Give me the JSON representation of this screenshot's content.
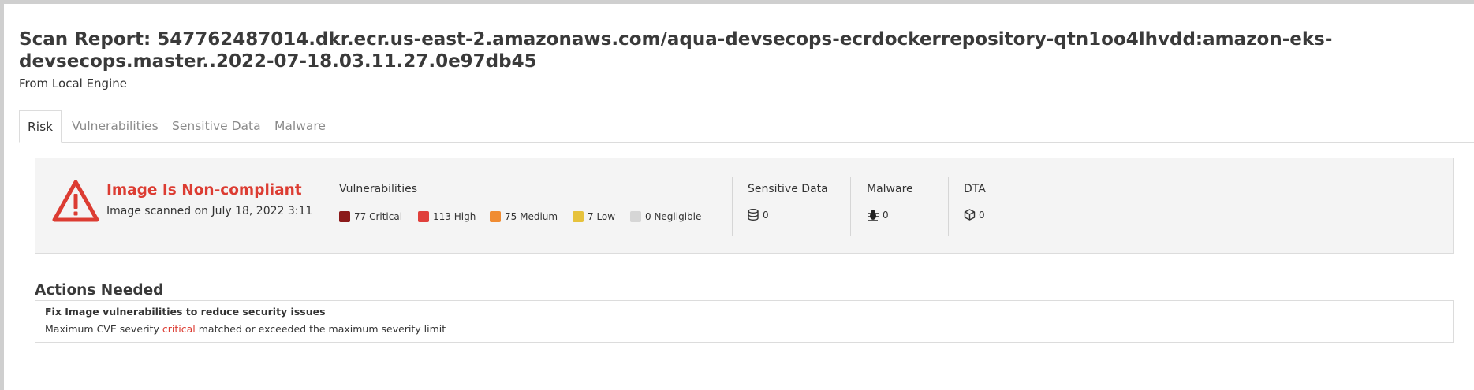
{
  "report": {
    "title": "Scan Report: 547762487014.dkr.ecr.us-east-2.amazonaws.com/aqua-devsecops-ecrdockerrepository-qtn1oo4lhvdd:amazon-eks-devsecops.master..2022-07-18.03.11.27.0e97db45",
    "source": "From Local Engine"
  },
  "tabs": [
    {
      "label": "Risk",
      "active": true
    },
    {
      "label": "Vulnerabilities",
      "active": false
    },
    {
      "label": "Sensitive Data",
      "active": false
    },
    {
      "label": "Malware",
      "active": false
    }
  ],
  "summary": {
    "status_title": "Image Is Non-compliant",
    "scanned_text": "Image scanned on July 18, 2022 3:11",
    "status_color": "#dc3c32",
    "vulnerabilities": {
      "heading": "Vulnerabilities",
      "items": [
        {
          "label": "77 Critical",
          "color": "#8b1a1a"
        },
        {
          "label": "113 High",
          "color": "#e0403c"
        },
        {
          "label": "75 Medium",
          "color": "#f08c32"
        },
        {
          "label": "7 Low",
          "color": "#e6c23c"
        },
        {
          "label": "0 Negligible",
          "color": "#d6d6d6"
        }
      ]
    },
    "sensitive_data": {
      "heading": "Sensitive Data",
      "value": "0",
      "icon": "database-icon"
    },
    "malware": {
      "heading": "Malware",
      "value": "0",
      "icon": "bug-icon"
    },
    "dta": {
      "heading": "DTA",
      "value": "0",
      "icon": "cube-icon"
    }
  },
  "actions": {
    "title": "Actions Needed",
    "item_title": "Fix Image vulnerabilities to reduce security issues",
    "line_prefix": "Maximum CVE severity ",
    "line_highlight": "critical",
    "line_suffix": " matched or exceeded the maximum severity limit"
  }
}
